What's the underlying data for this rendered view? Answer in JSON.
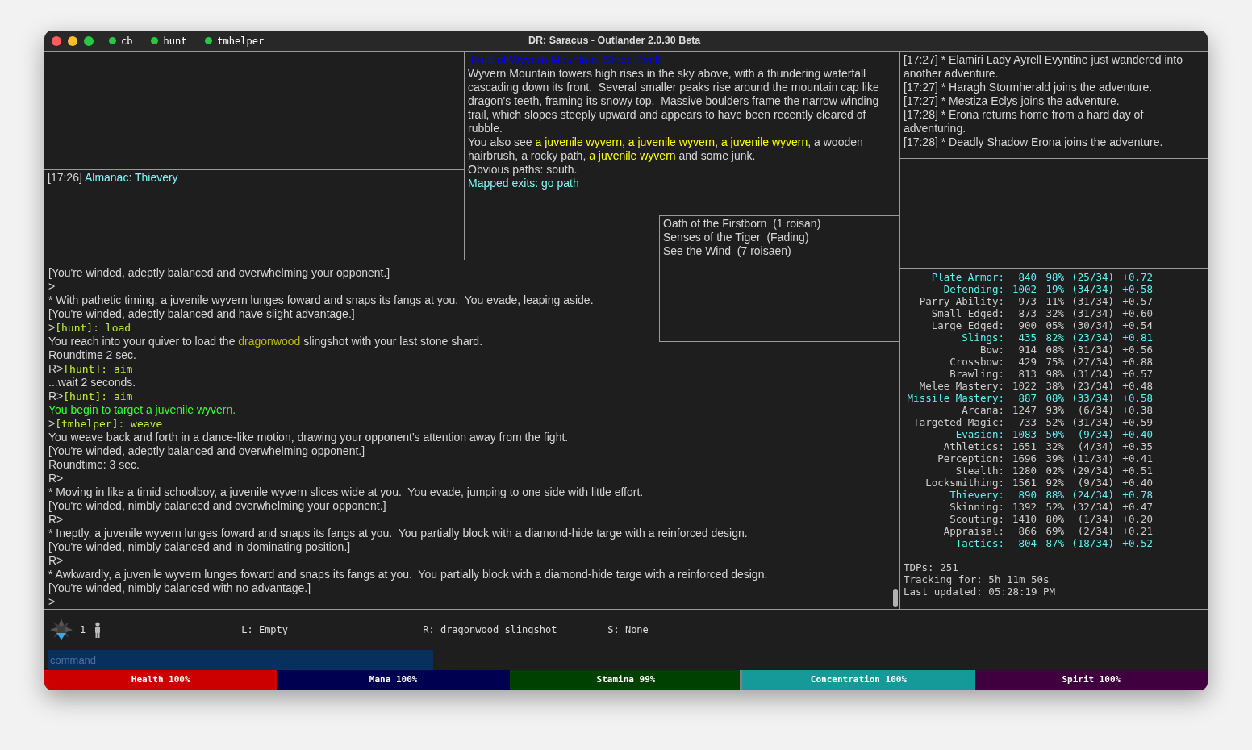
{
  "window": {
    "title": "DR: Saracus - Outlander 2.0.30 Beta"
  },
  "scripts": [
    {
      "name": "cb",
      "color": "#28c840"
    },
    {
      "name": "hunt",
      "color": "#28c840"
    },
    {
      "name": "tmhelper",
      "color": "#28c840"
    }
  ],
  "almanac": {
    "lines": [
      [
        {
          "text": "[17:26] ",
          "kind": "normal"
        },
        {
          "text": "Almanac: Thievery",
          "kind": "exit"
        }
      ]
    ]
  },
  "room": {
    "lines": [
      [
        {
          "text": "[Foot of Wyvern Mountain, Steep Trail]",
          "kind": "title"
        }
      ],
      [
        {
          "text": "Wyvern Mountain towers high rises in the sky above, with a thundering waterfall cascading down its front.  Several smaller peaks rise around the mountain cap like dragon's teeth, framing its snowy top.  Massive boulders frame the narrow winding trail, which slopes steeply upward and appears to have been recently cleared of rubble.",
          "kind": "normal"
        }
      ],
      [
        {
          "text": "You also see ",
          "kind": "normal"
        },
        {
          "text": "a juvenile wyvern",
          "kind": "creature"
        },
        {
          "text": ", ",
          "kind": "normal"
        },
        {
          "text": "a juvenile wyvern",
          "kind": "creature"
        },
        {
          "text": ", ",
          "kind": "normal"
        },
        {
          "text": "a juvenile wyvern",
          "kind": "creature"
        },
        {
          "text": ", a wooden hairbrush, a rocky path, ",
          "kind": "normal"
        },
        {
          "text": "a juvenile wyvern",
          "kind": "creature"
        },
        {
          "text": " and some junk.",
          "kind": "normal"
        }
      ],
      [
        {
          "text": "Obvious paths: south.",
          "kind": "normal"
        }
      ],
      [
        {
          "text": "Mapped exits: go path",
          "kind": "exit"
        }
      ]
    ]
  },
  "log": {
    "lines": [
      "[17:27] * Elamiri Lady Ayrell Evyntine just wandered into another adventure.",
      "[17:27] * Haragh Stormherald joins the adventure.",
      "[17:27] * Mestiza Eclys joins the adventure.",
      "[17:28] * Erona returns home from a hard day of adventuring.",
      "[17:28] * Deadly Shadow Erona joins the adventure."
    ]
  },
  "spells": [
    "Oath of the Firstborn  (1 roisan)",
    "Senses of the Tiger  (Fading)",
    "See the Wind  (7 roisaen)"
  ],
  "story": {
    "lines": [
      [
        {
          "text": "[You're winded, adeptly balanced and overwhelming your opponent.]",
          "kind": "normal"
        }
      ],
      [
        {
          "text": ">",
          "kind": "normal"
        }
      ],
      [
        {
          "text": "* With pathetic timing, a juvenile wyvern lunges foward and snaps its fangs at you.  You evade, leaping aside.",
          "kind": "normal"
        }
      ],
      [
        {
          "text": "[You're winded, adeptly balanced and have slight advantage.]",
          "kind": "normal"
        }
      ],
      [
        {
          "text": ">",
          "kind": "normal"
        },
        {
          "text": "[hunt]: load",
          "kind": "command"
        }
      ],
      [
        {
          "text": "You reach into your quiver to load the ",
          "kind": "normal"
        },
        {
          "text": "dragonwood",
          "kind": "item"
        },
        {
          "text": " slingshot with your last stone shard.",
          "kind": "normal"
        }
      ],
      [
        {
          "text": "Roundtime 2 sec.",
          "kind": "normal"
        }
      ],
      [
        {
          "text": "R>",
          "kind": "normal"
        },
        {
          "text": "[hunt]: aim",
          "kind": "command"
        }
      ],
      [
        {
          "text": "...wait 2 seconds.",
          "kind": "normal"
        }
      ],
      [
        {
          "text": "R>",
          "kind": "normal"
        },
        {
          "text": "[hunt]: aim",
          "kind": "command"
        }
      ],
      [
        {
          "text": "You begin to target a juvenile wyvern.",
          "kind": "speech"
        }
      ],
      [
        {
          "text": ">",
          "kind": "normal"
        },
        {
          "text": "[tmhelper]: weave",
          "kind": "command"
        }
      ],
      [
        {
          "text": "You weave back and forth in a dance-like motion, drawing your opponent's attention away from the fight.",
          "kind": "normal"
        }
      ],
      [
        {
          "text": "[You're winded, adeptly balanced and overwhelming opponent.]",
          "kind": "normal"
        }
      ],
      [
        {
          "text": "Roundtime: 3 sec.",
          "kind": "normal"
        }
      ],
      [
        {
          "text": "R>",
          "kind": "normal"
        }
      ],
      [
        {
          "text": "* Moving in like a timid schoolboy, a juvenile wyvern slices wide at you.  You evade, jumping to one side with little effort.",
          "kind": "normal"
        }
      ],
      [
        {
          "text": "[You're winded, nimbly balanced and overwhelming your opponent.]",
          "kind": "normal"
        }
      ],
      [
        {
          "text": "R>",
          "kind": "normal"
        }
      ],
      [
        {
          "text": "* Ineptly, a juvenile wyvern lunges foward and snaps its fangs at you.  You partially block with a diamond-hide targe with a reinforced design.",
          "kind": "normal"
        }
      ],
      [
        {
          "text": "[You're winded, nimbly balanced and in dominating position.]",
          "kind": "normal"
        }
      ],
      [
        {
          "text": "R>",
          "kind": "normal"
        }
      ],
      [
        {
          "text": "* Awkwardly, a juvenile wyvern lunges foward and snaps its fangs at you.  You partially block with a diamond-hide targe with a reinforced design.",
          "kind": "normal"
        }
      ],
      [
        {
          "text": "[You're winded, nimbly balanced with no advantage.]",
          "kind": "normal"
        }
      ],
      [
        {
          "text": ">",
          "kind": "normal"
        }
      ]
    ]
  },
  "skills": {
    "rows": [
      {
        "name": "Plate Armor:",
        "rank": "840",
        "percent": "98%",
        "mindstate": "(25/34)",
        "rate": "+0.72",
        "highlighted": true
      },
      {
        "name": "Defending:",
        "rank": "1002",
        "percent": "19%",
        "mindstate": "(34/34)",
        "rate": "+0.58",
        "highlighted": true
      },
      {
        "name": "Parry Ability:",
        "rank": "973",
        "percent": "11%",
        "mindstate": "(31/34)",
        "rate": "+0.57",
        "highlighted": false
      },
      {
        "name": "Small Edged:",
        "rank": "873",
        "percent": "32%",
        "mindstate": "(31/34)",
        "rate": "+0.60",
        "highlighted": false
      },
      {
        "name": "Large Edged:",
        "rank": "900",
        "percent": "05%",
        "mindstate": "(30/34)",
        "rate": "+0.54",
        "highlighted": false
      },
      {
        "name": "Slings:",
        "rank": "435",
        "percent": "82%",
        "mindstate": "(23/34)",
        "rate": "+0.81",
        "highlighted": true
      },
      {
        "name": "Bow:",
        "rank": "914",
        "percent": "08%",
        "mindstate": "(31/34)",
        "rate": "+0.56",
        "highlighted": false
      },
      {
        "name": "Crossbow:",
        "rank": "429",
        "percent": "75%",
        "mindstate": "(27/34)",
        "rate": "+0.88",
        "highlighted": false
      },
      {
        "name": "Brawling:",
        "rank": "813",
        "percent": "98%",
        "mindstate": "(31/34)",
        "rate": "+0.57",
        "highlighted": false
      },
      {
        "name": "Melee Mastery:",
        "rank": "1022",
        "percent": "38%",
        "mindstate": "(23/34)",
        "rate": "+0.48",
        "highlighted": false
      },
      {
        "name": "Missile Mastery:",
        "rank": "887",
        "percent": "08%",
        "mindstate": "(33/34)",
        "rate": "+0.58",
        "highlighted": true
      },
      {
        "name": "Arcana:",
        "rank": "1247",
        "percent": "93%",
        "mindstate": "(6/34)",
        "rate": "+0.38",
        "highlighted": false
      },
      {
        "name": "Targeted Magic:",
        "rank": "733",
        "percent": "52%",
        "mindstate": "(31/34)",
        "rate": "+0.59",
        "highlighted": false
      },
      {
        "name": "Evasion:",
        "rank": "1083",
        "percent": "50%",
        "mindstate": "(9/34)",
        "rate": "+0.40",
        "highlighted": true
      },
      {
        "name": "Athletics:",
        "rank": "1651",
        "percent": "32%",
        "mindstate": "(4/34)",
        "rate": "+0.35",
        "highlighted": false
      },
      {
        "name": "Perception:",
        "rank": "1696",
        "percent": "39%",
        "mindstate": "(11/34)",
        "rate": "+0.41",
        "highlighted": false
      },
      {
        "name": "Stealth:",
        "rank": "1280",
        "percent": "02%",
        "mindstate": "(29/34)",
        "rate": "+0.51",
        "highlighted": false
      },
      {
        "name": "Locksmithing:",
        "rank": "1561",
        "percent": "92%",
        "mindstate": "(9/34)",
        "rate": "+0.40",
        "highlighted": false
      },
      {
        "name": "Thievery:",
        "rank": "890",
        "percent": "88%",
        "mindstate": "(24/34)",
        "rate": "+0.78",
        "highlighted": true
      },
      {
        "name": "Skinning:",
        "rank": "1392",
        "percent": "52%",
        "mindstate": "(32/34)",
        "rate": "+0.47",
        "highlighted": false
      },
      {
        "name": "Scouting:",
        "rank": "1410",
        "percent": "80%",
        "mindstate": "(1/34)",
        "rate": "+0.20",
        "highlighted": false
      },
      {
        "name": "Appraisal:",
        "rank": "866",
        "percent": "69%",
        "mindstate": "(2/34)",
        "rate": "+0.21",
        "highlighted": false
      },
      {
        "name": "Tactics:",
        "rank": "804",
        "percent": "87%",
        "mindstate": "(18/34)",
        "rate": "+0.52",
        "highlighted": true
      }
    ],
    "footer": [
      "TDPs: 251",
      "Tracking for: 5h 11m 50s",
      "Last updated: 05:28:19 PM"
    ]
  },
  "status": {
    "count": "1",
    "left_hand": "L: Empty",
    "right_hand": "R: dragonwood slingshot",
    "spell": "S: None"
  },
  "command": {
    "placeholder": "command"
  },
  "vitals": [
    {
      "label": "Health 100%",
      "level": 1,
      "color": "#cc0000"
    },
    {
      "label": "Mana 100%",
      "level": 1,
      "color": "#000050"
    },
    {
      "label": "Stamina 99%",
      "level": 0.99,
      "color": "#004000"
    },
    {
      "label": "Concentration 100%",
      "level": 1,
      "color": "#169999"
    },
    {
      "label": "Spirit 100%",
      "level": 1,
      "color": "#400040"
    }
  ]
}
